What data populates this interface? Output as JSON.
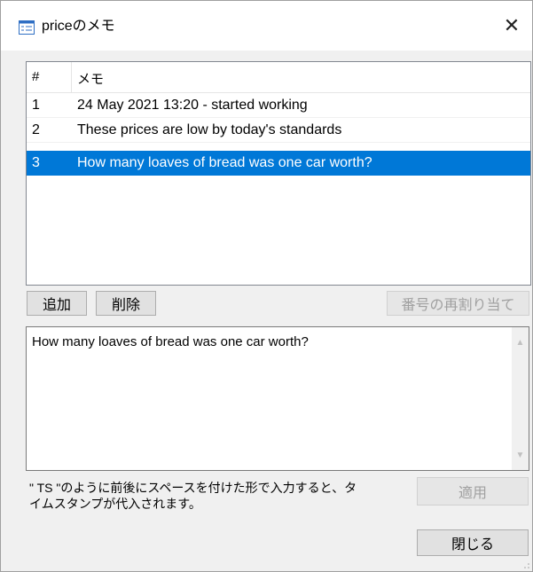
{
  "window": {
    "title": "priceのメモ",
    "close_glyph": "✕"
  },
  "list": {
    "headers": {
      "num": "#",
      "memo": "メモ"
    },
    "rows": [
      {
        "num": "1",
        "memo": "24 May 2021 13:20 - started working"
      },
      {
        "num": "2",
        "memo": "These prices are low by today's standards"
      },
      {
        "num": "3",
        "memo": "How many loaves of bread was one car worth?",
        "selected": true
      }
    ]
  },
  "buttons": {
    "add": "追加",
    "delete": "削除",
    "renumber": "番号の再割り当て",
    "apply": "適用",
    "close": "閉じる"
  },
  "editor": {
    "text": "How many loaves of bread was one car worth?"
  },
  "hint": {
    "line1": "\" TS \"のように前後にスペースを付けた形で入力すると、タ",
    "line2": "イムスタンプが代入されます。"
  },
  "colors": {
    "selection": "#0078d7",
    "disabled_text": "#a0a0a0"
  }
}
